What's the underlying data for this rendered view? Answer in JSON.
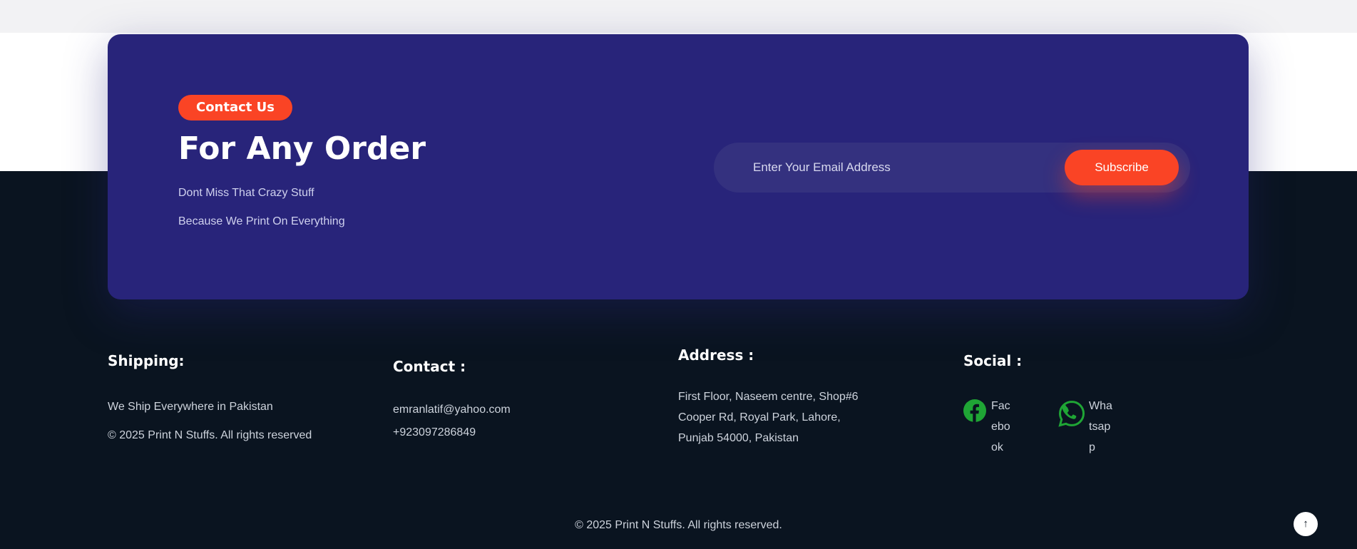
{
  "cta": {
    "badge": "Contact Us",
    "title": "For Any Order",
    "line1": "Dont Miss That Crazy Stuff",
    "line2": "Because We Print On Everything",
    "email_placeholder": "Enter Your Email Address",
    "email_value": "",
    "subscribe_label": "Subscribe"
  },
  "footer": {
    "shipping": {
      "heading": "Shipping:",
      "text": "We Ship Everywhere in Pakistan",
      "copyright": "© 2025 Print N Stuffs. All rights reserved"
    },
    "contact": {
      "heading": "Contact :",
      "email": "emranlatif@yahoo.com",
      "phone": "+923097286849"
    },
    "address": {
      "heading": "Address :",
      "line1": "First Floor, Naseem centre, Shop#6",
      "line2": "Cooper Rd, Royal Park, Lahore,",
      "line3": "Punjab 54000, Pakistan"
    },
    "social": {
      "heading": "Social :",
      "items": [
        {
          "label": "Facebook",
          "icon": "facebook-icon",
          "color": "#1fa535"
        },
        {
          "label": "Whatsapp",
          "icon": "whatsapp-icon",
          "color": "#1fa535"
        }
      ]
    },
    "bottom_copyright": "© 2025 Print N Stuffs. All rights reserved.",
    "back_to_top_icon": "arrow-up-icon"
  },
  "colors": {
    "accent": "#fa4425",
    "card": "#28247a",
    "footer_bg": "#0a1420",
    "social_green": "#1fa535"
  }
}
